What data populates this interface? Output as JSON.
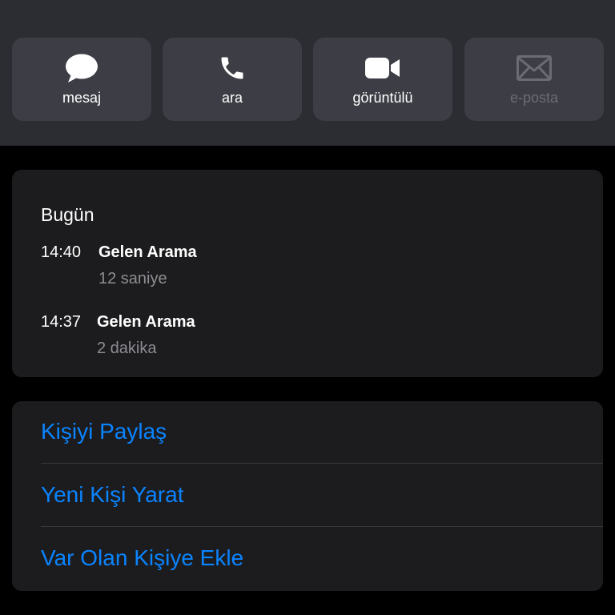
{
  "header": {
    "actions": [
      {
        "label": "mesaj",
        "icon": "message-bubble-icon",
        "enabled": true
      },
      {
        "label": "ara",
        "icon": "phone-icon",
        "enabled": true
      },
      {
        "label": "görüntülü",
        "icon": "video-camera-icon",
        "enabled": true
      },
      {
        "label": "e-posta",
        "icon": "envelope-icon",
        "enabled": false
      }
    ]
  },
  "history": {
    "day": "Bugün",
    "calls": [
      {
        "time": "14:40",
        "type": "Gelen Arama",
        "duration": "12 saniye"
      },
      {
        "time": "14:37",
        "type": "Gelen Arama",
        "duration": "2 dakika"
      }
    ]
  },
  "contact_actions": [
    {
      "label": "Kişiyi Paylaş"
    },
    {
      "label": "Yeni Kişi Yarat"
    },
    {
      "label": "Var Olan Kişiye Ekle"
    }
  ],
  "colors": {
    "accent": "#0a84ff",
    "header_bg": "#2c2d33",
    "button_bg": "#3d3e45",
    "card_bg": "#1c1c1e",
    "secondary_text": "#8d8d93",
    "disabled_text": "#6b6c73"
  }
}
